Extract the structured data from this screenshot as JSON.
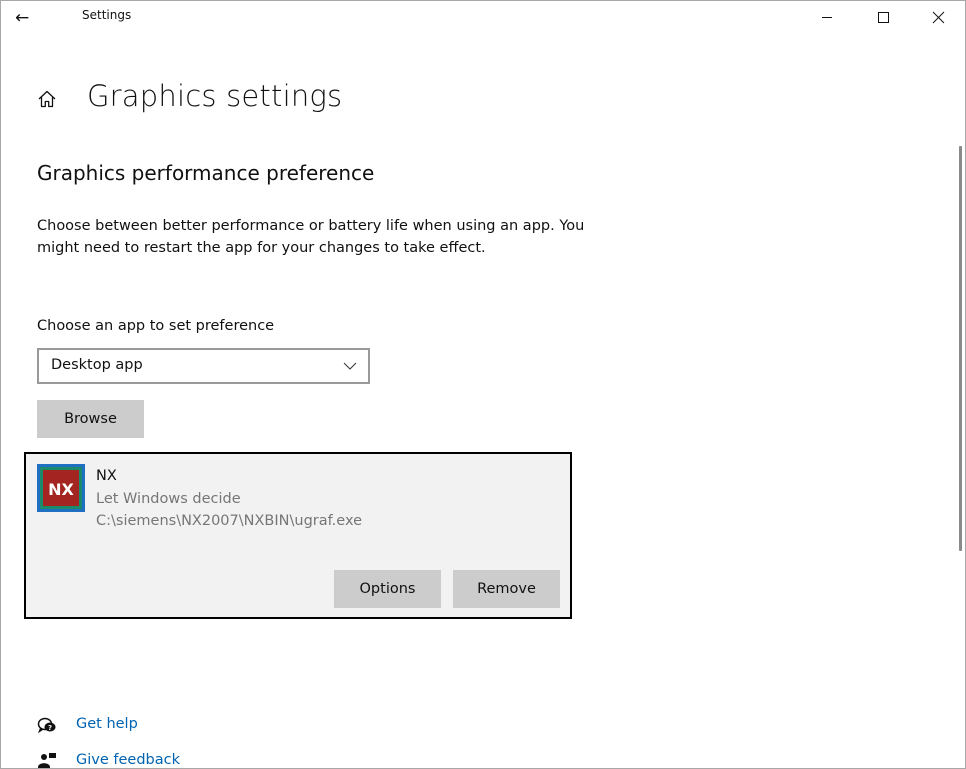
{
  "window": {
    "title": "Settings",
    "back_glyph": "←",
    "controls": {
      "minimize_icon": "minimize-icon",
      "maximize_icon": "maximize-icon",
      "close_icon": "close-icon"
    }
  },
  "header": {
    "home_icon": "home-icon",
    "title": "Graphics settings"
  },
  "section": {
    "title": "Graphics performance preference",
    "description": "Choose between better performance or battery life when using an app. You might need to restart the app for your changes to take effect."
  },
  "app_picker": {
    "label": "Choose an app to set preference",
    "selected": "Desktop app",
    "browse_label": "Browse"
  },
  "app_list": [
    {
      "name": "NX",
      "icon_text": "NX",
      "preference": "Let Windows decide",
      "path": "C:\\siemens\\NX2007\\NXBIN\\ugraf.exe",
      "options_label": "Options",
      "remove_label": "Remove"
    }
  ],
  "footer": {
    "help_label": "Get help",
    "feedback_label": "Give feedback"
  },
  "colors": {
    "accent_link": "#0063b1",
    "button_bg": "#cccccc",
    "card_bg": "#f2f2f2",
    "nx_icon_red": "#a32420",
    "nx_icon_blue": "#1f6fc2"
  }
}
